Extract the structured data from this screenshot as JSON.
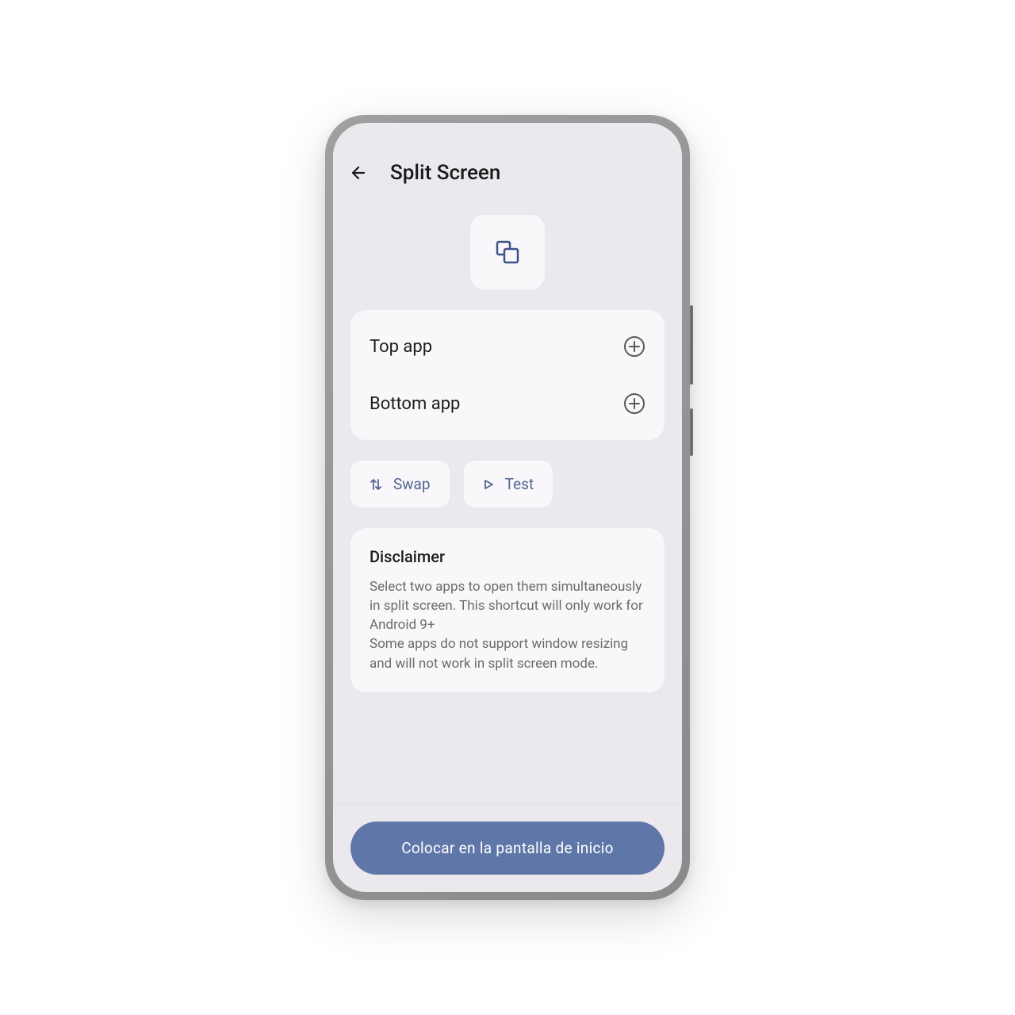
{
  "header": {
    "title": "Split Screen"
  },
  "apps": {
    "top_label": "Top app",
    "bottom_label": "Bottom app"
  },
  "actions": {
    "swap_label": "Swap",
    "test_label": "Test"
  },
  "disclaimer": {
    "title": "Disclaimer",
    "body_1": "Select two apps to open them simultaneously in split screen. This shortcut will only work for Android 9+",
    "body_2": "Some apps do not support window resizing and will not work in split screen mode."
  },
  "footer": {
    "primary_label": "Colocar en la pantalla de inicio"
  },
  "colors": {
    "accent": "#5f77a8",
    "icon_accent": "#3d5488"
  }
}
